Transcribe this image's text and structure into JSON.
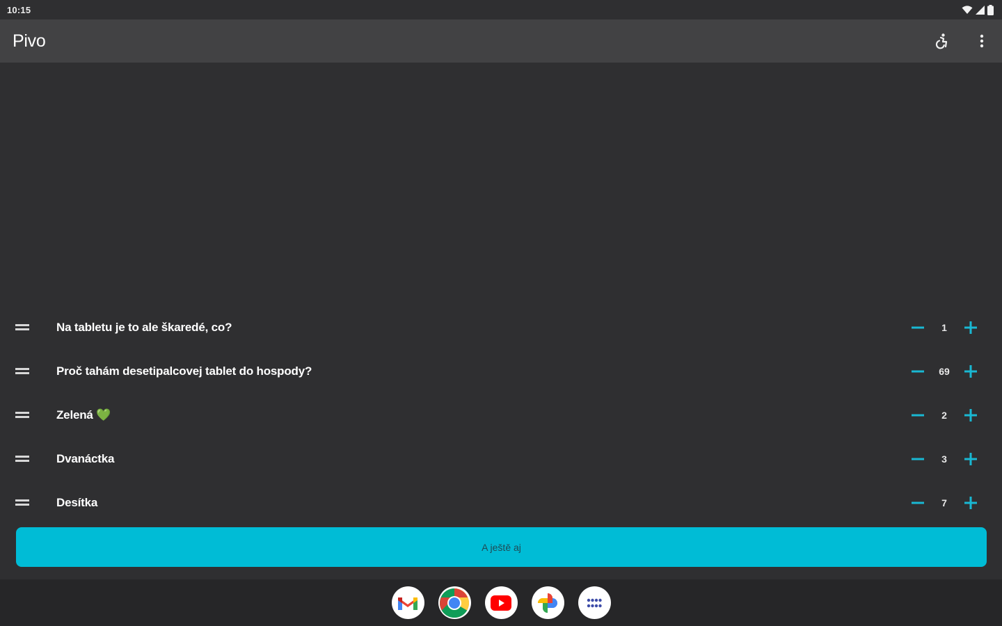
{
  "status_bar": {
    "time": "10:15"
  },
  "app_bar": {
    "title": "Pivo",
    "actions": [
      {
        "name": "accessibility-icon"
      },
      {
        "name": "more-vert-icon"
      }
    ]
  },
  "items": [
    {
      "label": "Na tabletu je to ale škaredé, co?",
      "count": "1"
    },
    {
      "label": "Proč tahám desetipalcovej tablet do hospody?",
      "count": "69"
    },
    {
      "label": "Zelená 💚",
      "count": "2"
    },
    {
      "label": "Dvanáctka",
      "count": "3"
    },
    {
      "label": "Desítka",
      "count": "7"
    }
  ],
  "add_button_label": "A ještě aj",
  "dock": [
    {
      "name": "gmail-icon"
    },
    {
      "name": "chrome-icon"
    },
    {
      "name": "youtube-icon"
    },
    {
      "name": "photos-icon"
    },
    {
      "name": "app-drawer-icon"
    }
  ],
  "colors": {
    "background": "#2f2f31",
    "app_bar": "#424244",
    "accent": "#00bcd6",
    "nav_bar": "#262628"
  }
}
